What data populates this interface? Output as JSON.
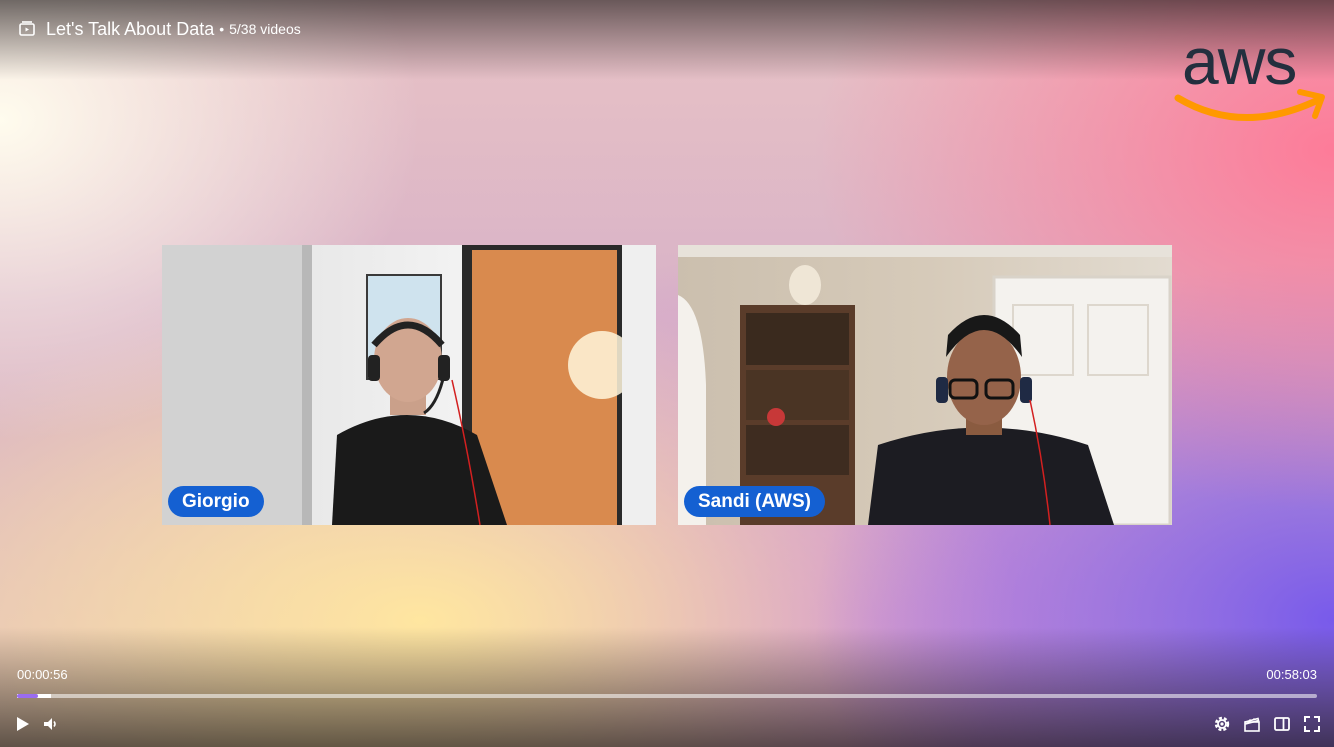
{
  "header": {
    "playlist_title": "Let's Talk About Data",
    "separator": "•",
    "video_count": "5/38 videos"
  },
  "participants": [
    {
      "name": "Giorgio"
    },
    {
      "name": "Sandi (AWS)"
    }
  ],
  "logo_text": "aws",
  "player": {
    "current_time": "00:00:56",
    "duration": "00:58:03",
    "progress_fraction": 0.016,
    "buffered_fraction": 0.026
  },
  "colors": {
    "accent": "#9a6cf0",
    "name_pill": "#1460d2",
    "aws_orange": "#ff9900",
    "aws_text": "#232f3e"
  },
  "icons": {
    "playlist": "playlist-icon",
    "play": "play-icon",
    "volume": "volume-icon",
    "settings": "gear-icon",
    "chapters": "clapperboard-icon",
    "sidebar": "sidebar-panel-icon",
    "fullscreen": "fullscreen-icon"
  }
}
